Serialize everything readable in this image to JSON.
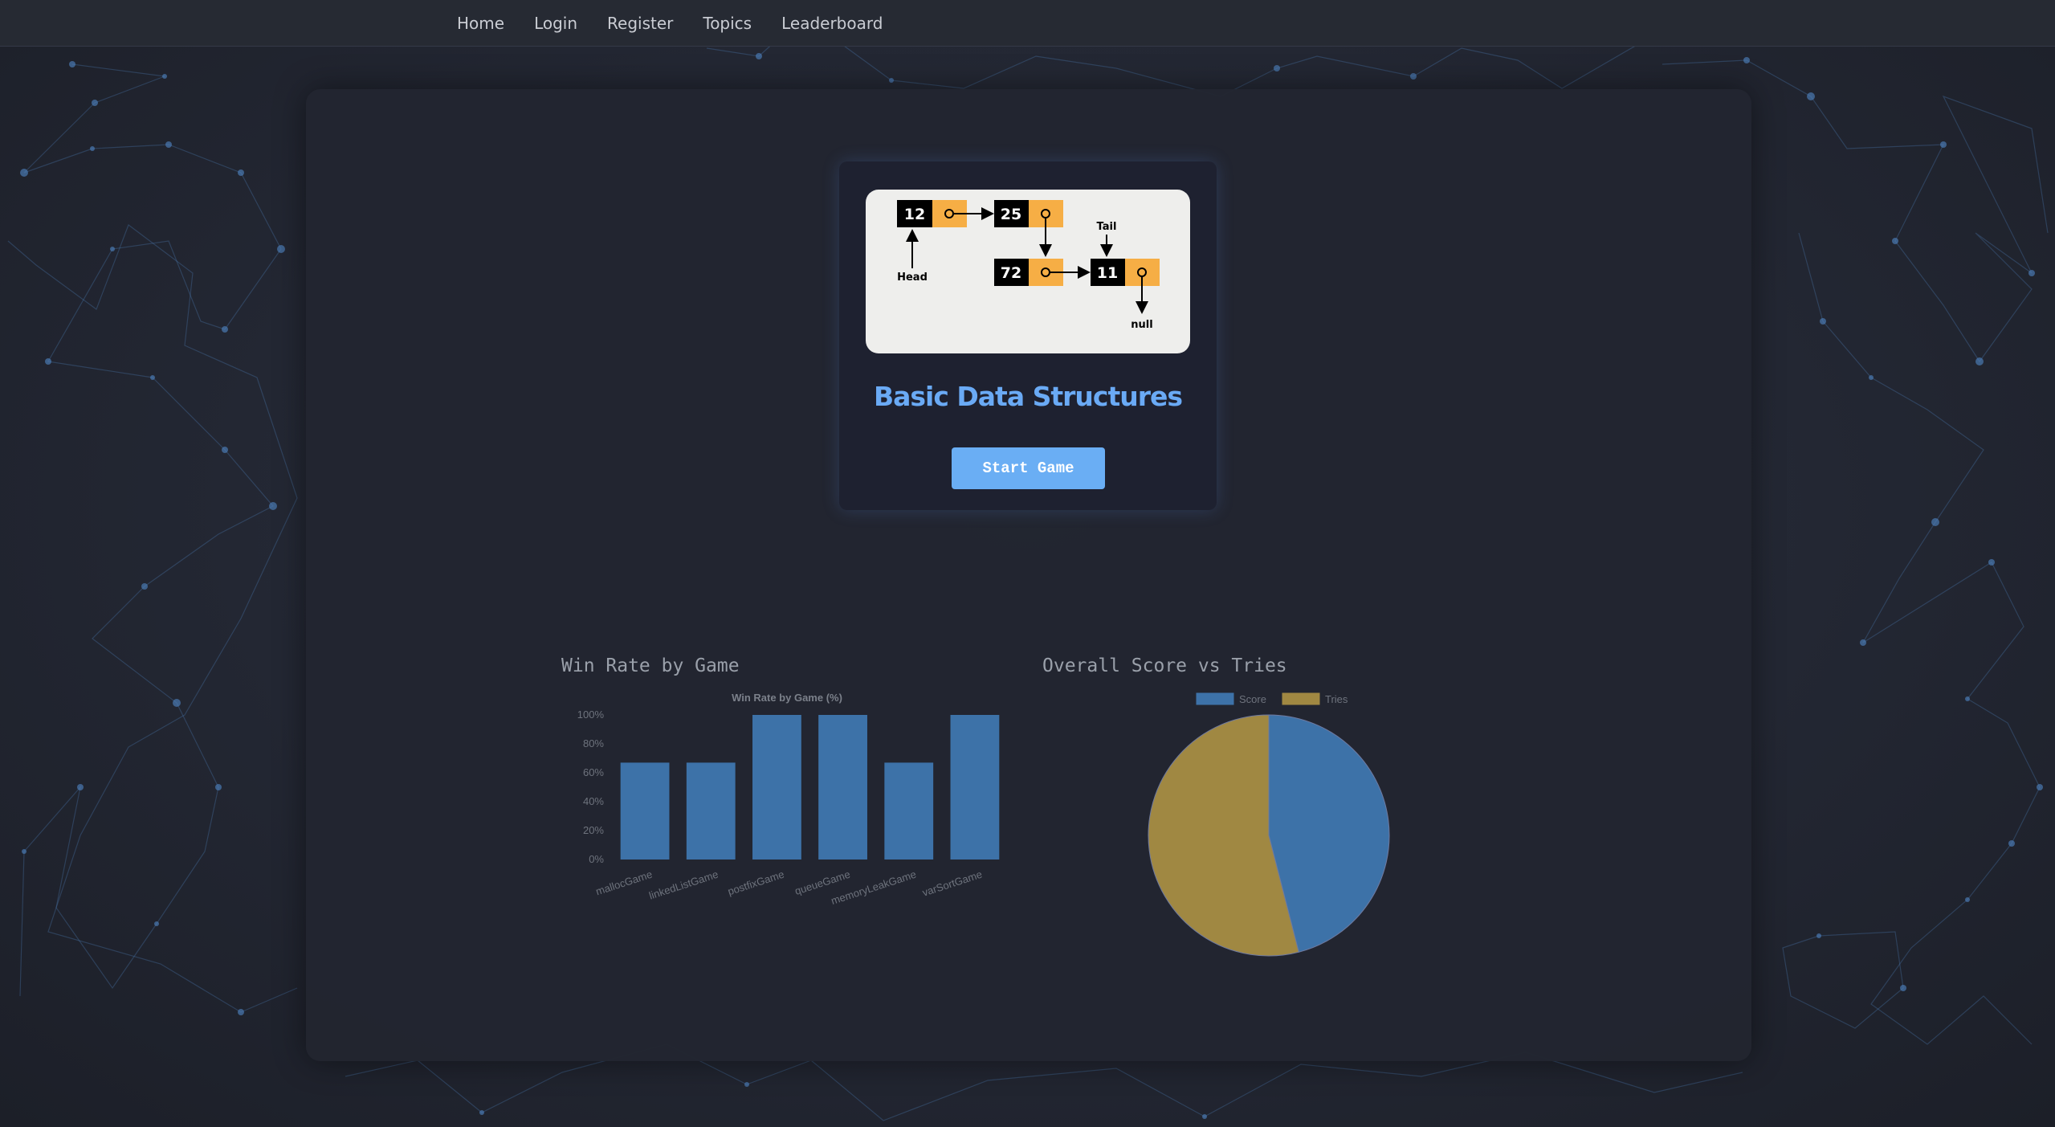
{
  "nav": {
    "items": [
      {
        "label": "Home"
      },
      {
        "label": "Login"
      },
      {
        "label": "Register"
      },
      {
        "label": "Topics"
      },
      {
        "label": "Leaderboard"
      }
    ]
  },
  "topic_card": {
    "title": "Basic Data Structures",
    "button_label": "Start Game",
    "diagram": {
      "nodes": [
        "12",
        "25",
        "72",
        "11"
      ],
      "head_label": "Head",
      "tail_label": "Tail",
      "null_label": "null"
    }
  },
  "charts": {
    "win_rate_heading": "Win Rate by Game",
    "score_heading": "Overall Score vs Tries"
  },
  "colors": {
    "bar_blue": "#3d72a8",
    "pie_gold": "#a08842",
    "title_blue": "#6aaaf5",
    "button_blue": "#6aaef4",
    "node_orange": "#f6ae45"
  },
  "chart_data": [
    {
      "type": "bar",
      "title": "Win Rate by Game (%)",
      "categories": [
        "mallocGame",
        "linkedListGame",
        "postfixGame",
        "queueGame",
        "memoryLeakGame",
        "varSortGame"
      ],
      "values": [
        67,
        67,
        100,
        100,
        67,
        100
      ],
      "y_ticks": [
        "0%",
        "20%",
        "40%",
        "60%",
        "80%",
        "100%"
      ],
      "ylim": [
        0,
        100
      ],
      "grid": false
    },
    {
      "type": "pie",
      "legend_position": "top",
      "labels": [
        "Score",
        "Tries"
      ],
      "values": [
        46,
        54
      ],
      "colors": [
        "#3d72a8",
        "#a08842"
      ]
    }
  ]
}
